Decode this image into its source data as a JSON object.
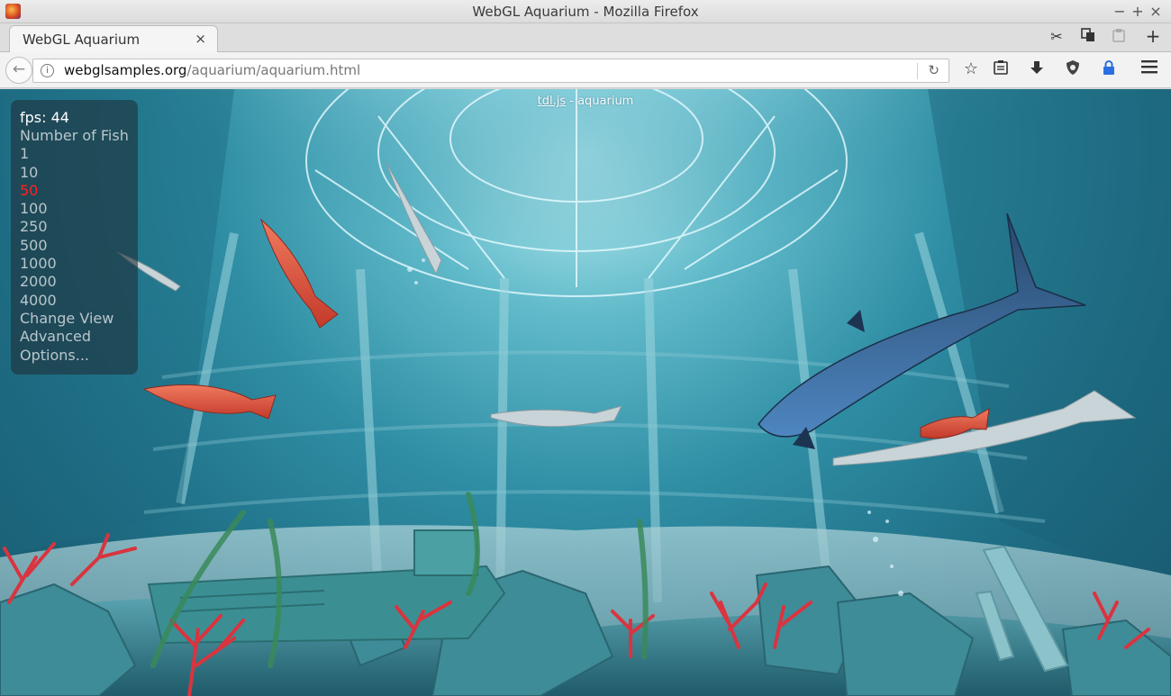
{
  "window": {
    "title": "WebGL Aquarium - Mozilla Firefox",
    "controls": {
      "minimize": "−",
      "maximize": "+",
      "close": "×"
    }
  },
  "tab": {
    "label": "WebGL Aquarium",
    "close": "×"
  },
  "navbar": {
    "url_domain": "webglsamples.org",
    "url_path": "/aquarium/aquarium.html"
  },
  "page": {
    "credit_link": "tdl.js",
    "credit_suffix": " - aquarium",
    "fps_label": "fps: 44",
    "menu_items": [
      {
        "label": "Number of Fish",
        "selected": false
      },
      {
        "label": "1",
        "selected": false
      },
      {
        "label": "10",
        "selected": false
      },
      {
        "label": "50",
        "selected": true
      },
      {
        "label": "100",
        "selected": false
      },
      {
        "label": "250",
        "selected": false
      },
      {
        "label": "500",
        "selected": false
      },
      {
        "label": "1000",
        "selected": false
      },
      {
        "label": "2000",
        "selected": false
      },
      {
        "label": "4000",
        "selected": false
      },
      {
        "label": "Change View",
        "selected": false
      },
      {
        "label": "Advanced",
        "selected": false
      },
      {
        "label": "Options...",
        "selected": false
      }
    ]
  },
  "icons": {
    "toolbar_right": [
      "scissors-icon",
      "copy-icon",
      "clipboard-icon",
      "new-tab-icon"
    ],
    "nav_right": [
      "bookmark-star-icon",
      "reader-icon",
      "download-icon",
      "shield-icon",
      "lock-icon",
      "hamburger-menu-icon"
    ]
  },
  "colors": {
    "selected_item": "#ff2020",
    "menu_text": "#b9c6cc",
    "water": "#2f8ea4"
  }
}
